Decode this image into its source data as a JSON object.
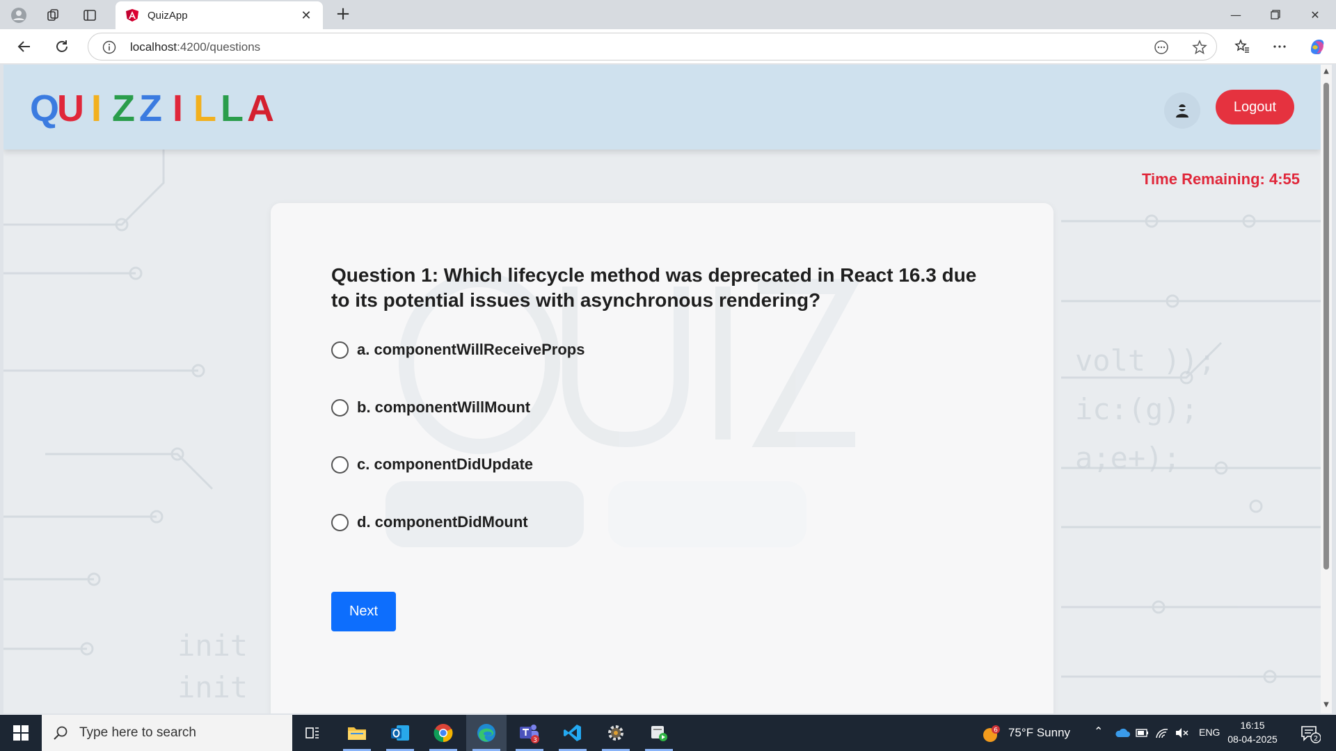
{
  "browser": {
    "tab_title": "QuizApp",
    "url_host": "localhost",
    "url_path": ":4200/questions"
  },
  "header": {
    "logo_letters": [
      {
        "char": "Q",
        "color": "#3b7be0"
      },
      {
        "char": "U",
        "color": "#e0273a"
      },
      {
        "char": "I",
        "color": "#f2b01e"
      },
      {
        "char": "Z",
        "color": "#2a9d4b"
      },
      {
        "char": "Z",
        "color": "#3b7be0"
      },
      {
        "char": "I",
        "color": "#e0273a"
      },
      {
        "char": "L",
        "color": "#f2b01e"
      },
      {
        "char": "L",
        "color": "#2a9d4b"
      },
      {
        "char": "A",
        "color": "#d4202f"
      }
    ],
    "user_icon": "user-avatar-icon",
    "logout_label": "Logout"
  },
  "timer": {
    "text": "Time Remaining: 4:55"
  },
  "quiz": {
    "question": "Question 1: Which lifecycle method was deprecated in React 16.3 due to its potential issues with asynchronous rendering?",
    "options": [
      {
        "label": "a. componentWillReceiveProps"
      },
      {
        "label": "b. componentWillMount"
      },
      {
        "label": "c. componentDidUpdate"
      },
      {
        "label": "d. componentDidMount"
      }
    ],
    "next_label": "Next"
  },
  "taskbar": {
    "search_placeholder": "Type here to search",
    "weather": "75°F  Sunny",
    "weather_badge": "6",
    "language": "ENG",
    "time": "16:15",
    "date": "08-04-2025",
    "notification_count": "2",
    "teams_badge": "3"
  },
  "colors": {
    "accent_blue": "#0d6efd",
    "logout_red": "#e5323f",
    "timer_red": "#e0273a",
    "header_bg": "#cfe1ee"
  }
}
